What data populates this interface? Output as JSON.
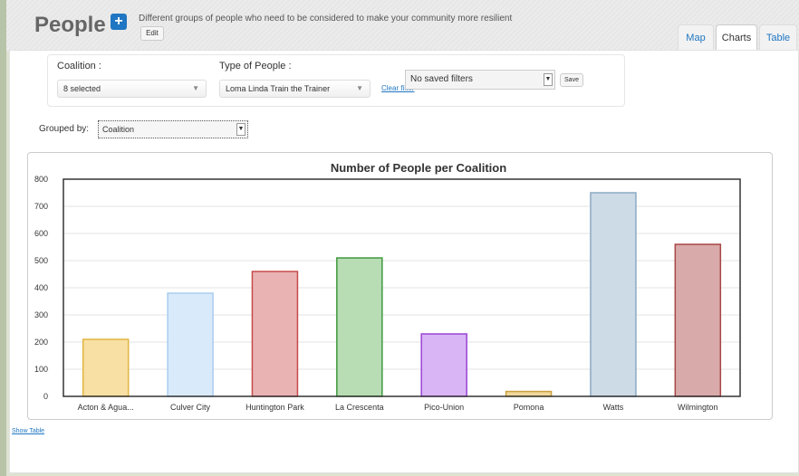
{
  "header": {
    "title": "People",
    "add_icon": "plus-icon",
    "description": "Different groups of people who need to be considered to make your community more resilient",
    "edit_label": "Edit",
    "tabs": [
      {
        "label": "Map",
        "active": false
      },
      {
        "label": "Charts",
        "active": true
      },
      {
        "label": "Table",
        "active": false
      }
    ]
  },
  "filters": {
    "coalition_label": "Coalition :",
    "coalition_value": "8 selected",
    "type_label": "Type of People :",
    "type_value": "Loma Linda Train the Trainer",
    "clear_label": "Clear filter",
    "saved_value": "No saved filters",
    "save_label": "Save"
  },
  "grouping": {
    "label": "Grouped by:",
    "value": "Coalition"
  },
  "show_table_label": "Show Table",
  "chart_data": {
    "type": "bar",
    "title": "Number of People per Coalition",
    "categories": [
      "Acton & Agua...",
      "Culver City",
      "Huntington Park",
      "La Crescenta",
      "Pico-Union",
      "Pomona",
      "Watts",
      "Wilmington"
    ],
    "values": [
      210,
      380,
      460,
      510,
      230,
      18,
      750,
      560
    ],
    "ylim": [
      0,
      800
    ],
    "yticks": [
      0,
      100,
      200,
      300,
      400,
      500,
      600,
      700,
      800
    ],
    "grid": true,
    "colors": [
      {
        "fill": "#f8e0a4",
        "stroke": "#e0b640"
      },
      {
        "fill": "#d9eafa",
        "stroke": "#a9cdee"
      },
      {
        "fill": "#e9b3b3",
        "stroke": "#c84a4a"
      },
      {
        "fill": "#b8dcb4",
        "stroke": "#3f9a3f"
      },
      {
        "fill": "#d9b5f5",
        "stroke": "#9a44d6"
      },
      {
        "fill": "#f0d79a",
        "stroke": "#c9a03d"
      },
      {
        "fill": "#cddbe6",
        "stroke": "#8caac3"
      },
      {
        "fill": "#d9aaaa",
        "stroke": "#a84545"
      }
    ]
  }
}
